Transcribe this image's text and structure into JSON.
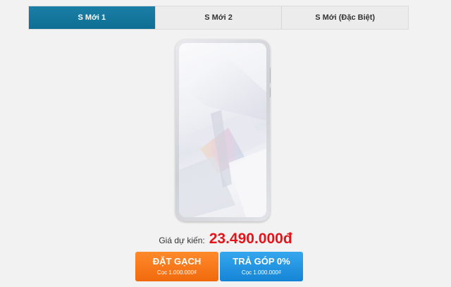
{
  "tabs": [
    {
      "label": "S Mới 1",
      "active": true
    },
    {
      "label": "S Mới 2",
      "active": false
    },
    {
      "label": "S Mới (Đặc Biệt)",
      "active": false
    }
  ],
  "product": {
    "image": "phone-front-icon"
  },
  "price": {
    "label": "Giá dự kiến:",
    "value": "23.490.000đ"
  },
  "buttons": {
    "preorder": {
      "title": "ĐẶT GẠCH",
      "sub": "Cọc 1.000.000₫"
    },
    "installment": {
      "title": "TRẢ GÓP 0%",
      "sub": "Cọc 1.000.000₫"
    }
  },
  "colors": {
    "active_tab": "#0f6e93",
    "price": "#e4141b",
    "preorder_button": "#f06a0d",
    "installment_button": "#1584d6"
  }
}
